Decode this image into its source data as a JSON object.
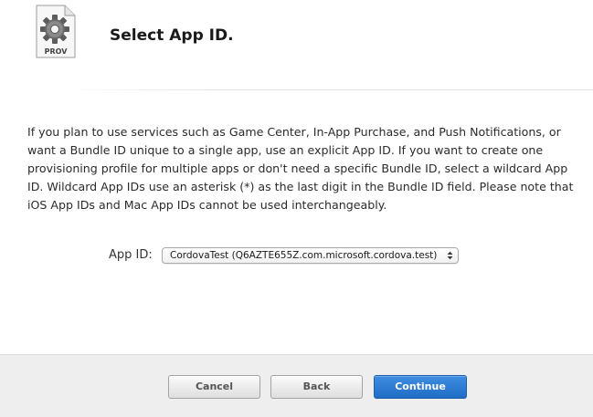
{
  "header": {
    "icon": "provisioning-profile-gear-icon",
    "icon_label": "PROV",
    "title": "Select App ID."
  },
  "description": "If you plan to use services such as Game Center, In-App Purchase, and Push Notifications, or want a Bundle ID unique to a single app, use an explicit App ID. If you want to create one provisioning profile for multiple apps or don't need a specific Bundle ID, select a wildcard App ID. Wildcard App IDs use an asterisk (*) as the last digit in the Bundle ID field. Please note that iOS App IDs and Mac App IDs cannot be used interchangeably.",
  "app_id": {
    "label": "App ID:",
    "selected": "CordovaTest (Q6AZTE655Z.com.microsoft.cordova.test)",
    "icon": "updown-chevron-icon"
  },
  "footer": {
    "cancel_label": "Cancel",
    "back_label": "Back",
    "continue_label": "Continue"
  },
  "colors": {
    "primary_button": "#2a7ad6",
    "footer_background": "#eeeeee",
    "text": "#2b2b2b"
  }
}
